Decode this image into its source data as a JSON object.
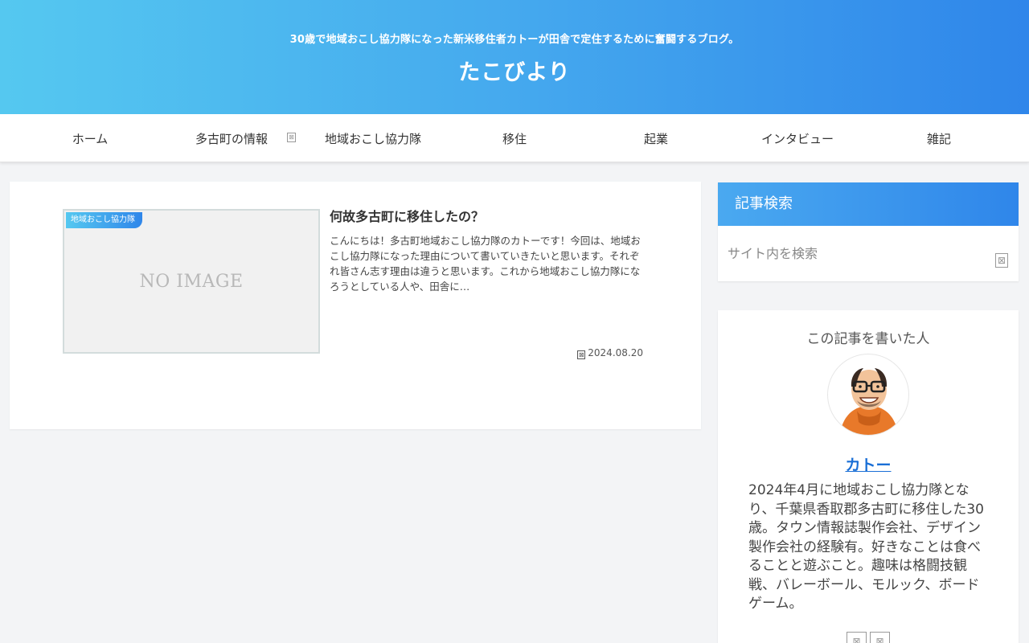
{
  "header": {
    "tagline": "30歳で地域おこし協力隊になった新米移住者カトーが田舎で定住するために奮闘するブログ。",
    "title": "たこびより"
  },
  "nav": {
    "items": [
      {
        "label": "ホーム"
      },
      {
        "label": "多古町の情報",
        "has_submenu": true
      },
      {
        "label": "地域おこし協力隊"
      },
      {
        "label": "移住"
      },
      {
        "label": "起業"
      },
      {
        "label": "インタビュー"
      },
      {
        "label": "雑記"
      }
    ],
    "submenu_glyph": "⊠"
  },
  "entry": {
    "category": "地域おこし協力隊",
    "thumbnail_text": "NO IMAGE",
    "title": "何故多古町に移住したの？",
    "snippet": "こんにちは！多古町地域おこし協力隊のカトーです！今回は、地域おこし協力隊になった理由について書いていきたいと思います。それぞれ皆さん志す理由は違うと思います。これから地域おこし協力隊になろうとしている人や、田舎に…",
    "date": "2024.08.20",
    "date_icon_glyph": "⊠"
  },
  "sidebar": {
    "search": {
      "title": "記事検索",
      "placeholder": "サイト内を検索",
      "button_glyph": "⊠"
    },
    "author": {
      "heading": "この記事を書いた人",
      "name": "カトー",
      "bio": "2024年4月に地域おこし協力隊となり、千葉県香取郡多古町に移住した30歳。タウン情報誌製作会社、デザイン製作会社の経験有。好きなことは食べることと遊ぶこと。趣味は格闘技観戦、バレーボール、モルック、ボードゲーム。",
      "sns_glyphs": [
        "⊠",
        "⊠"
      ]
    }
  },
  "colors": {
    "header_gradient_start": "#55c8f0",
    "header_gradient_end": "#2f86ea",
    "link": "#1a6fd6"
  }
}
